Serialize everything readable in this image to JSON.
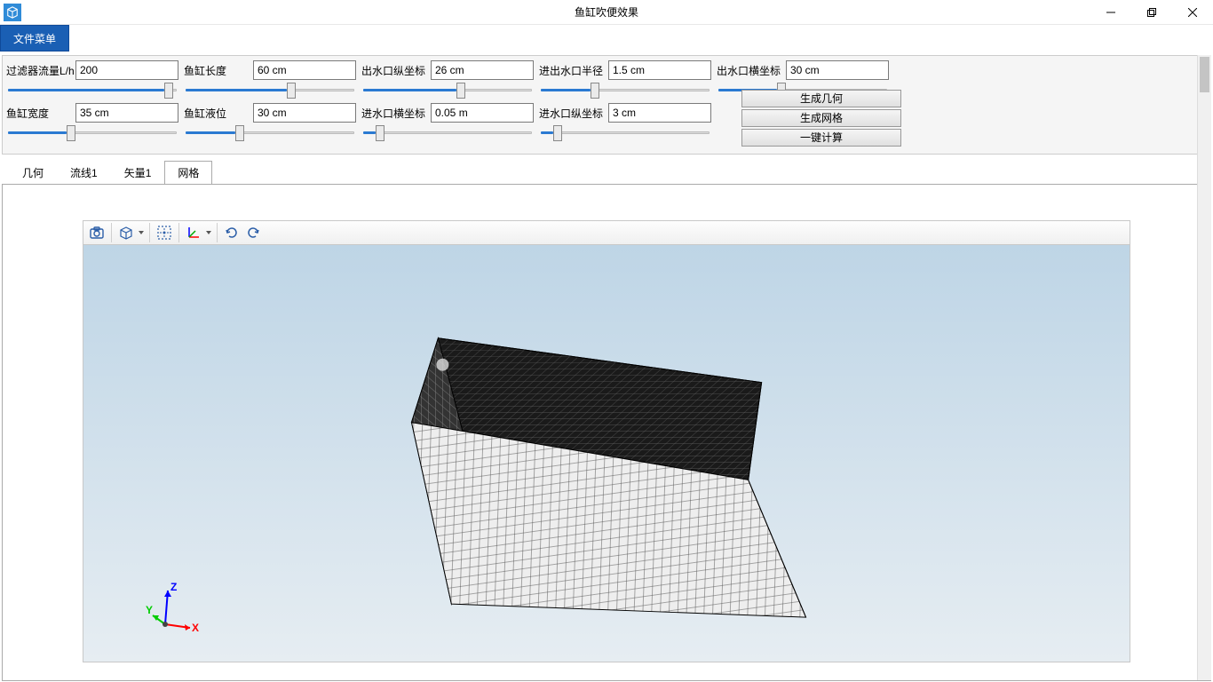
{
  "window": {
    "title": "鱼缸吹便效果"
  },
  "menu": {
    "file": "文件菜单"
  },
  "params": {
    "row1": [
      {
        "label": "过滤器流量L/h",
        "value": "200",
        "pos": 92
      },
      {
        "label": "鱼缸长度",
        "value": "60 cm",
        "pos": 60
      },
      {
        "label": "出水口纵坐标",
        "value": "26 cm",
        "pos": 55
      },
      {
        "label": "进出水口半径",
        "value": "1.5 cm",
        "pos": 30
      },
      {
        "label": "出水口横坐标",
        "value": "30 cm",
        "pos": 35
      }
    ],
    "row2": [
      {
        "label": "鱼缸宽度",
        "value": "35 cm",
        "pos": 35
      },
      {
        "label": "鱼缸液位",
        "value": "30 cm",
        "pos": 30
      },
      {
        "label": "进水口横坐标",
        "value": "0.05 m",
        "pos": 8
      },
      {
        "label": "进水口纵坐标",
        "value": "3 cm",
        "pos": 8
      }
    ]
  },
  "buttons": {
    "gen_geom": "生成几何",
    "gen_mesh": "生成网格",
    "calc": "一键计算"
  },
  "tabs": {
    "geom": "几何",
    "stream1": "流线1",
    "vec1": "矢量1",
    "mesh": "网格"
  },
  "axes": {
    "x": "X",
    "y": "Y",
    "z": "Z"
  }
}
